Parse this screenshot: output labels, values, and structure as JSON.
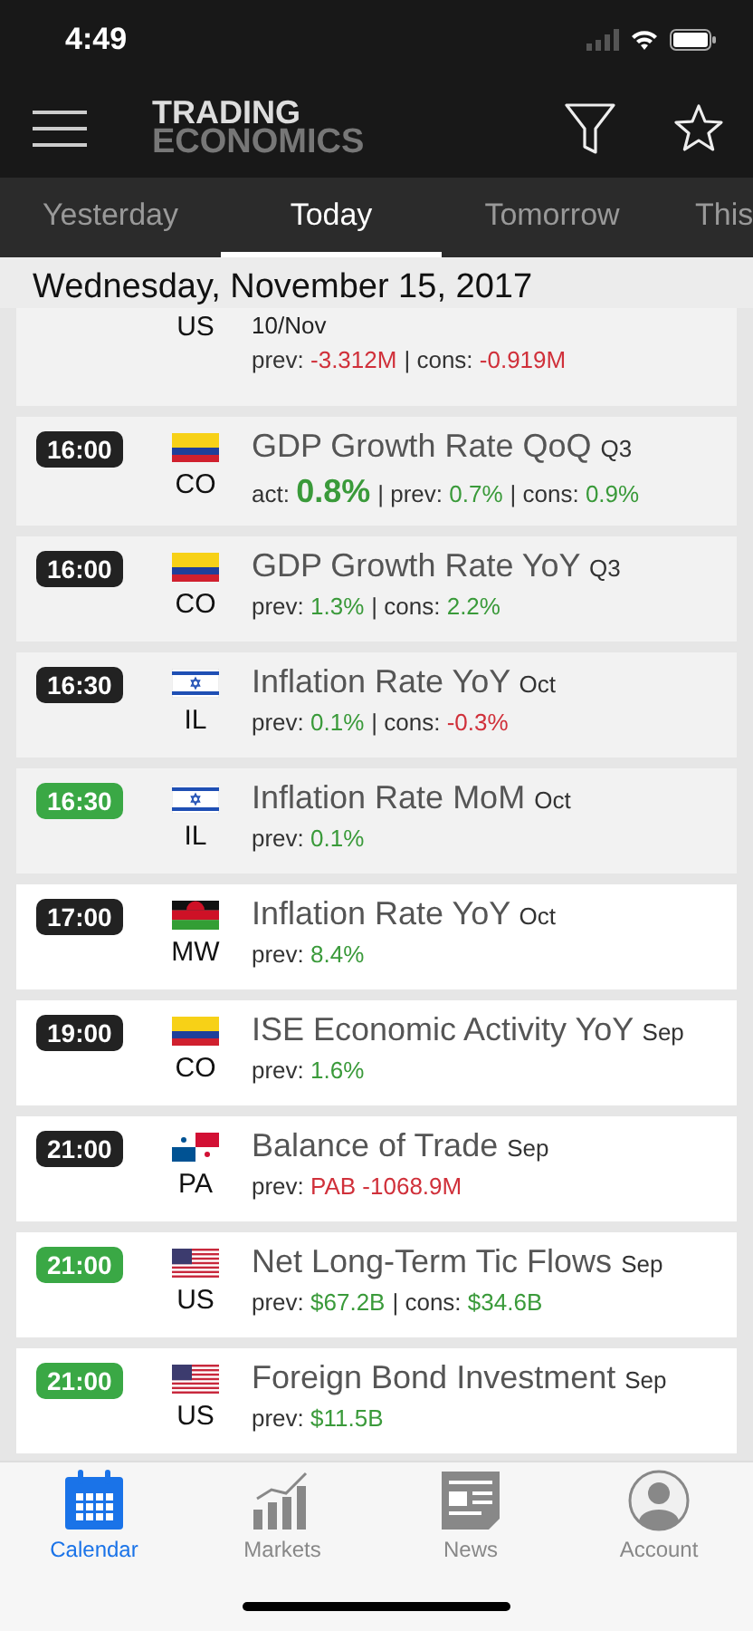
{
  "status_bar": {
    "time": "4:49"
  },
  "header": {
    "logo_top": "TRADING",
    "logo_bottom": "ECONOMICS"
  },
  "tabs": [
    {
      "label": "Yesterday",
      "selected": false
    },
    {
      "label": "Today",
      "selected": true
    },
    {
      "label": "Tomorrow",
      "selected": false
    },
    {
      "label": "This",
      "selected": false
    }
  ],
  "date_heading": "Wednesday, November 15, 2017",
  "partial_event": {
    "country": "US",
    "period": "10/Nov",
    "values": [
      {
        "label": "prev:",
        "value": "-3.312M",
        "color": "#d0303a"
      },
      {
        "label": "| cons:",
        "value": "-0.919M",
        "color": "#d0303a"
      }
    ]
  },
  "events": [
    {
      "time": "16:00",
      "color": "#222222",
      "past": true,
      "country": "CO",
      "title": "GDP Growth Rate QoQ",
      "period": "Q3",
      "values": [
        {
          "label": "act:",
          "value": "0.8%",
          "color": "#3a9a3a",
          "kind": "actual"
        },
        {
          "label": "| prev:",
          "value": "0.7%",
          "color": "#3a9a3a",
          "kind": "reference"
        },
        {
          "label": "| cons:",
          "value": "0.9%",
          "color": "#3a9a3a",
          "kind": "reference"
        }
      ]
    },
    {
      "time": "16:00",
      "color": "#222222",
      "past": true,
      "country": "CO",
      "title": "GDP Growth Rate YoY",
      "period": "Q3",
      "values": [
        {
          "label": "prev:",
          "value": "1.3%",
          "color": "#3a9a3a",
          "kind": "reference"
        },
        {
          "label": "| cons:",
          "value": "2.2%",
          "color": "#3a9a3a",
          "kind": "reference"
        }
      ]
    },
    {
      "time": "16:30",
      "color": "#222222",
      "past": true,
      "country": "IL",
      "title": "Inflation Rate YoY",
      "period": "Oct",
      "values": [
        {
          "label": "prev:",
          "value": "0.1%",
          "color": "#3a9a3a",
          "kind": "reference"
        },
        {
          "label": "| cons:",
          "value": "-0.3%",
          "color": "#d0303a",
          "kind": "reference"
        }
      ]
    },
    {
      "time": "16:30",
      "color": "#3aa845",
      "past": true,
      "country": "IL",
      "title": "Inflation Rate MoM",
      "period": "Oct",
      "values": [
        {
          "label": "prev:",
          "value": "0.1%",
          "color": "#3a9a3a",
          "kind": "reference"
        }
      ]
    },
    {
      "time": "17:00",
      "color": "#222222",
      "past": false,
      "country": "MW",
      "title": "Inflation Rate YoY",
      "period": "Oct",
      "values": [
        {
          "label": "prev:",
          "value": "8.4%",
          "color": "#3a9a3a",
          "kind": "reference"
        }
      ]
    },
    {
      "time": "19:00",
      "color": "#222222",
      "past": false,
      "country": "CO",
      "title": "ISE Economic Activity YoY",
      "period": "Sep",
      "values": [
        {
          "label": "prev:",
          "value": "1.6%",
          "color": "#3a9a3a",
          "kind": "reference"
        }
      ]
    },
    {
      "time": "21:00",
      "color": "#222222",
      "past": false,
      "country": "PA",
      "title": "Balance of Trade",
      "period": "Sep",
      "values": [
        {
          "label": "prev:",
          "value": "PAB -1068.9M",
          "color": "#d0303a",
          "kind": "reference"
        }
      ]
    },
    {
      "time": "21:00",
      "color": "#3aa845",
      "past": false,
      "country": "US",
      "title": "Net Long-Term Tic Flows",
      "period": "Sep",
      "values": [
        {
          "label": "prev:",
          "value": "$67.2B",
          "color": "#3a9a3a",
          "kind": "reference"
        },
        {
          "label": "| cons:",
          "value": "$34.6B",
          "color": "#3a9a3a",
          "kind": "reference"
        }
      ]
    },
    {
      "time": "21:00",
      "color": "#3aa845",
      "past": false,
      "country": "US",
      "title": "Foreign Bond Investment",
      "period": "Sep",
      "values": [
        {
          "label": "prev:",
          "value": "$11.5B",
          "color": "#3a9a3a",
          "kind": "reference"
        }
      ]
    }
  ],
  "bottom_nav": [
    {
      "label": "Calendar",
      "selected": true
    },
    {
      "label": "Markets",
      "selected": false
    },
    {
      "label": "News",
      "selected": false
    },
    {
      "label": "Account",
      "selected": false
    }
  ]
}
